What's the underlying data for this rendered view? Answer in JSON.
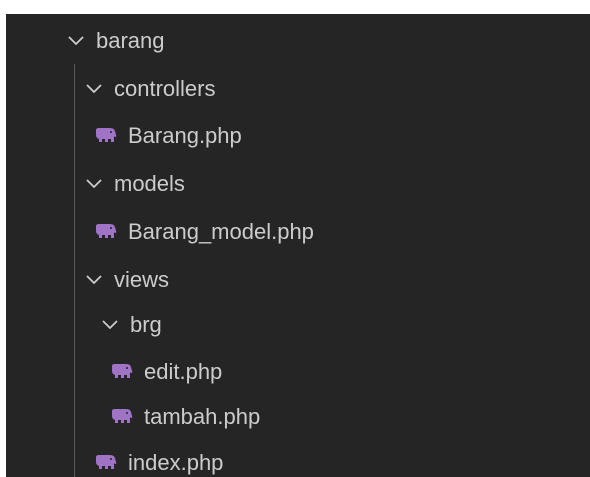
{
  "tree": {
    "root": {
      "label": "barang",
      "icon": "chevron-down-icon"
    },
    "controllers": {
      "label": "controllers",
      "icon": "chevron-down-icon"
    },
    "barang_php": {
      "label": "Barang.php",
      "icon": "php-elephant-icon"
    },
    "models": {
      "label": "models",
      "icon": "chevron-down-icon"
    },
    "barang_model_php": {
      "label": "Barang_model.php",
      "icon": "php-elephant-icon"
    },
    "views": {
      "label": "views",
      "icon": "chevron-down-icon"
    },
    "brg": {
      "label": "brg",
      "icon": "chevron-down-icon"
    },
    "edit_php": {
      "label": "edit.php",
      "icon": "php-elephant-icon"
    },
    "tambah_php": {
      "label": "tambah.php",
      "icon": "php-elephant-icon"
    },
    "index_php": {
      "label": "index.php",
      "icon": "php-elephant-icon"
    }
  },
  "colors": {
    "background": "#252526",
    "text": "#cccccc",
    "php_icon": "#a074c4",
    "indent_guide": "#585858"
  }
}
